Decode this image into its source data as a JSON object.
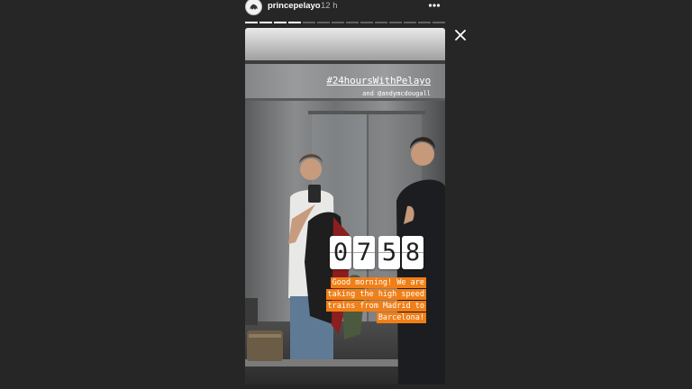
{
  "header": {
    "username": "princepelayo",
    "time": "12 h",
    "more_icon": "more-horizontal-icon",
    "close_icon": "close-icon"
  },
  "progress": {
    "segments_total": 14,
    "segments_done": 4
  },
  "story": {
    "hashtag": "#24hoursWithPelayo",
    "mention": "and @andymcdougall",
    "clock_digits": [
      "0",
      "7",
      "5",
      "8"
    ],
    "caption_lines": [
      "Good morning! We are",
      "taking the high speed",
      "trains from Madrid to",
      "Barcelona!"
    ]
  },
  "colors": {
    "background": "#262626",
    "caption_highlight": "#f07f18"
  }
}
